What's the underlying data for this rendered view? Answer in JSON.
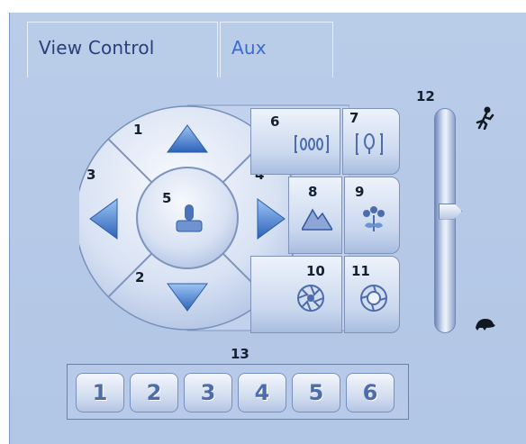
{
  "tabs": [
    {
      "label": "View Control"
    },
    {
      "label": "Aux"
    }
  ],
  "ptz": {
    "up": {
      "number": "1",
      "icon": "arrow-up-icon"
    },
    "down": {
      "number": "2",
      "icon": "arrow-down-icon"
    },
    "left": {
      "number": "3",
      "icon": "arrow-left-icon"
    },
    "right": {
      "number": "4",
      "icon": "arrow-right-icon"
    },
    "center": {
      "number": "5",
      "icon": "joystick-icon"
    }
  },
  "lens": {
    "zoom_out": {
      "number": "6",
      "icon": "zoom-out-icon"
    },
    "zoom_in": {
      "number": "7",
      "icon": "zoom-in-icon"
    },
    "focus_far": {
      "number": "8",
      "icon": "mountain-icon"
    },
    "focus_near": {
      "number": "9",
      "icon": "flower-icon"
    },
    "iris_close": {
      "number": "10",
      "icon": "iris-closed-icon"
    },
    "iris_open": {
      "number": "11",
      "icon": "iris-open-icon"
    }
  },
  "speed": {
    "number": "12",
    "fast_icon": "running-person-icon",
    "slow_icon": "turtle-icon",
    "level": 0.55
  },
  "presets": {
    "number": "13",
    "items": [
      "1",
      "2",
      "3",
      "4",
      "5",
      "6"
    ]
  },
  "colors": {
    "tab_bar": "#2f58b6",
    "panel": "#b9cce8",
    "active_tab_text": "#27407a",
    "inactive_tab_text": "#3a6bd0"
  }
}
